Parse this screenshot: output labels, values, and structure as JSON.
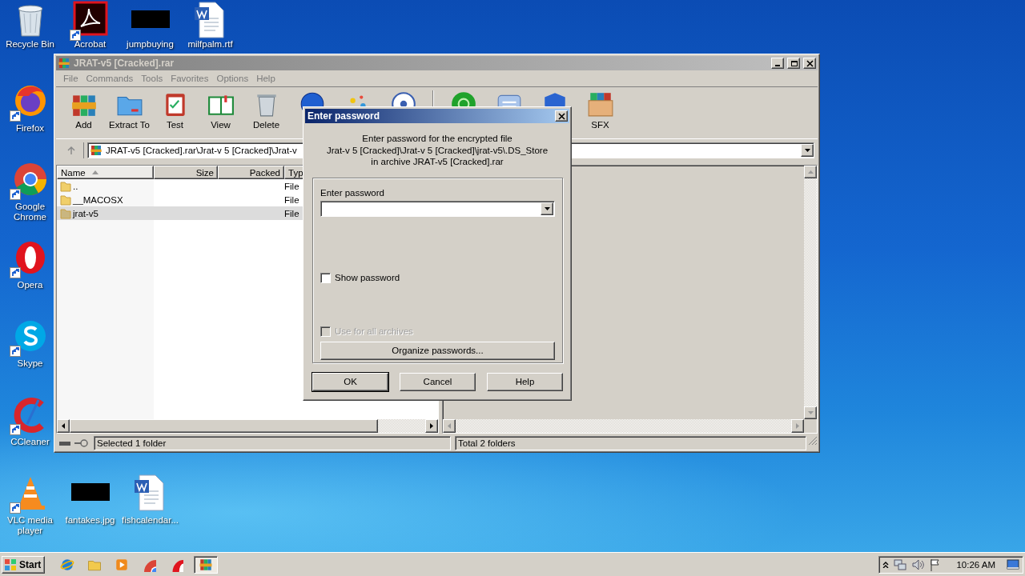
{
  "desktop_icons": [
    {
      "label": "Recycle Bin",
      "kind": "recycle",
      "shortcut": false
    },
    {
      "label": "Acrobat",
      "kind": "acrobat",
      "shortcut": true
    },
    {
      "label": "jumpbuying",
      "kind": "thumbnail",
      "shortcut": false
    },
    {
      "label": "milfpalm.rtf",
      "kind": "document",
      "shortcut": false
    },
    {
      "label": "Firefox",
      "kind": "firefox",
      "shortcut": true
    },
    {
      "label": "Google Chrome",
      "kind": "chrome",
      "shortcut": true
    },
    {
      "label": "Opera",
      "kind": "opera",
      "shortcut": true
    },
    {
      "label": "Skype",
      "kind": "skype",
      "shortcut": true
    },
    {
      "label": "CCleaner",
      "kind": "ccleaner",
      "shortcut": true
    },
    {
      "label": "VLC media player",
      "kind": "vlc",
      "shortcut": true
    },
    {
      "label": "fantakes.jpg",
      "kind": "thumbnail",
      "shortcut": false
    },
    {
      "label": "fishcalendar...",
      "kind": "document",
      "shortcut": false
    }
  ],
  "rar_window": {
    "title": "JRAT-v5 [Cracked].rar",
    "menu": [
      {
        "label": "File",
        "disabled": true
      },
      {
        "label": "Commands",
        "disabled": true
      },
      {
        "label": "Tools",
        "disabled": true
      },
      {
        "label": "Favorites",
        "disabled": true
      },
      {
        "label": "Options",
        "disabled": true
      },
      {
        "label": "Help",
        "disabled": true
      }
    ],
    "toolbar": [
      {
        "label": "Add",
        "kind": "add"
      },
      {
        "label": "Extract To",
        "kind": "extract"
      },
      {
        "label": "Test",
        "kind": "test"
      },
      {
        "label": "View",
        "kind": "view"
      },
      {
        "label": "Delete",
        "kind": "delete"
      },
      {
        "kind": "find"
      },
      {
        "kind": "wizard"
      },
      {
        "kind": "info"
      },
      {
        "kind": "separator"
      },
      {
        "kind": "virus"
      },
      {
        "kind": "comment"
      },
      {
        "kind": "protect"
      },
      {
        "label": "SFX",
        "kind": "sfx"
      }
    ],
    "address": "JRAT-v5 [Cracked].rar\\Jrat-v 5 [Cracked]\\Jrat-v",
    "columns": [
      {
        "label": "Name",
        "sorted": true
      },
      {
        "label": "Size",
        "sorted": false
      },
      {
        "label": "Packed",
        "sorted": false
      },
      {
        "label": "Typ",
        "sorted": false
      }
    ],
    "rows": [
      {
        "name": "..",
        "type": "File",
        "selected": false
      },
      {
        "name": "__MACOSX",
        "type": "File",
        "selected": false
      },
      {
        "name": "jrat-v5",
        "type": "File",
        "selected": true
      }
    ],
    "status_left": "Selected 1 folder",
    "status_right": "Total 2 folders"
  },
  "dialog": {
    "title": "Enter password",
    "message": "Enter password for the encrypted file\nJrat-v 5 [Cracked]\\Jrat-v 5 [Cracked]\\jrat-v5\\.DS_Store\nin archive JRAT-v5 [Cracked].rar",
    "field_label": "Enter password",
    "checkboxes": [
      {
        "label": "Show password",
        "checked": false,
        "disabled": false
      },
      {
        "label": "Use for all archives",
        "checked": false,
        "disabled": true
      }
    ],
    "organize_button": "Organize passwords...",
    "buttons": [
      {
        "label": "OK",
        "default": true
      },
      {
        "label": "Cancel",
        "default": false
      },
      {
        "label": "Help",
        "default": false
      }
    ]
  },
  "taskbar": {
    "start": "Start",
    "apps": [
      {
        "kind": "ie",
        "active": false
      },
      {
        "kind": "explorer",
        "active": false
      },
      {
        "kind": "media",
        "active": false
      },
      {
        "kind": "chrome",
        "active": false
      },
      {
        "kind": "opera",
        "active": false
      },
      {
        "kind": "winrar",
        "active": true
      }
    ],
    "time": "10:26 AM"
  }
}
